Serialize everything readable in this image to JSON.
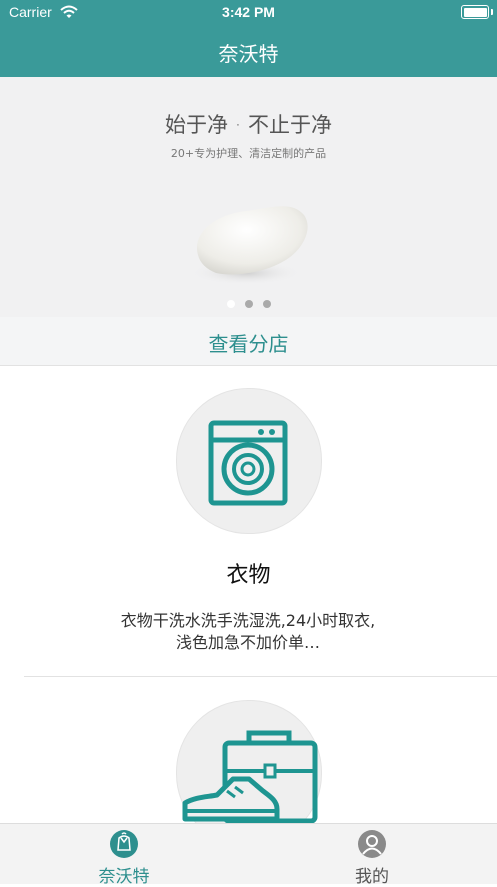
{
  "status_bar": {
    "carrier": "Carrier",
    "time": "3:42 PM"
  },
  "nav": {
    "title": "奈沃特"
  },
  "banner": {
    "headline": "始于净 · 不止于净",
    "subline": "20+专为护理、清洁定制的产品",
    "page_count": 3,
    "active_page": 1
  },
  "branch_link": {
    "label": "查看分店"
  },
  "services": [
    {
      "icon": "washing-machine-icon",
      "title": "衣物",
      "description": "衣物干洗水洗手洗湿洗,24小时取衣,浅色加急不加价单…"
    },
    {
      "icon": "shoe-bag-icon"
    }
  ],
  "tabs": [
    {
      "label": "奈沃特",
      "icon": "home-brand-icon",
      "active": true
    },
    {
      "label": "我的",
      "icon": "user-icon",
      "active": false
    }
  ],
  "colors": {
    "accent": "#3a9a99",
    "text_accent": "#2d8f8e",
    "icon_teal": "#1e9591"
  }
}
